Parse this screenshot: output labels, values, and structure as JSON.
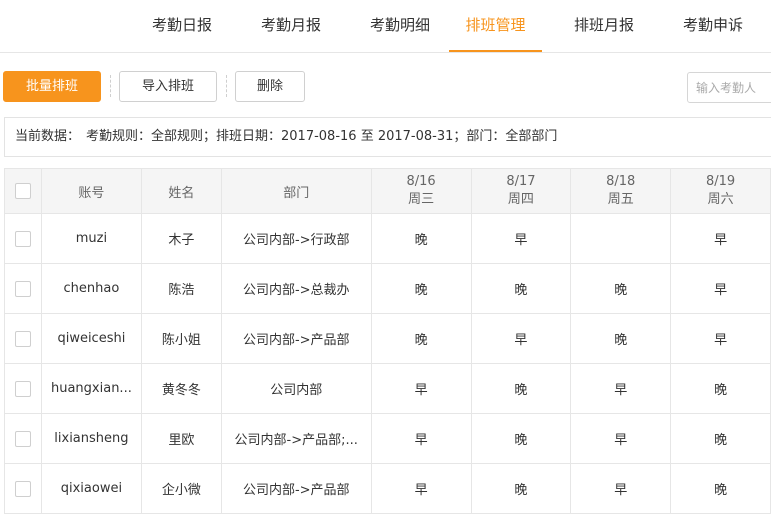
{
  "tabs": [
    {
      "label": "考勤日报",
      "active": false
    },
    {
      "label": "考勤月报",
      "active": false
    },
    {
      "label": "考勤明细",
      "active": false
    },
    {
      "label": "排班管理",
      "active": true
    },
    {
      "label": "排班月报",
      "active": false
    },
    {
      "label": "考勤申诉",
      "active": false
    }
  ],
  "toolbar": {
    "batch_label": "批量排班",
    "import_label": "导入排班",
    "delete_label": "删除",
    "search_placeholder": "输入考勤人"
  },
  "info": {
    "prefix": "当前数据：",
    "text": "考勤规则：全部规则；排班日期：2017-08-16 至 2017-08-31；部门：全部部门"
  },
  "table": {
    "headers": {
      "account": "账号",
      "name": "姓名",
      "dept": "部门"
    },
    "days": [
      {
        "date": "8/16",
        "weekday": "周三"
      },
      {
        "date": "8/17",
        "weekday": "周四"
      },
      {
        "date": "8/18",
        "weekday": "周五"
      },
      {
        "date": "8/19",
        "weekday": "周六"
      }
    ],
    "rows": [
      {
        "account": "muzi",
        "name": "木子",
        "dept": "公司内部->行政部",
        "shifts": [
          "晚",
          "早",
          "",
          "早"
        ]
      },
      {
        "account": "chenhao",
        "name": "陈浩",
        "dept": "公司内部->总裁办",
        "shifts": [
          "晚",
          "晚",
          "晚",
          "早"
        ]
      },
      {
        "account": "qiweiceshi",
        "name": "陈小姐",
        "dept": "公司内部->产品部",
        "shifts": [
          "晚",
          "早",
          "晚",
          "早"
        ]
      },
      {
        "account": "huangxian...",
        "name": "黄冬冬",
        "dept": "公司内部",
        "shifts": [
          "早",
          "晚",
          "早",
          "晚"
        ]
      },
      {
        "account": "lixiansheng",
        "name": "里欧",
        "dept": "公司内部->产品部;...",
        "shifts": [
          "早",
          "晚",
          "早",
          "晚"
        ]
      },
      {
        "account": "qixiaowei",
        "name": "企小微",
        "dept": "公司内部->产品部",
        "shifts": [
          "早",
          "晚",
          "早",
          "晚"
        ]
      }
    ]
  },
  "colors": {
    "accent": "#f7941d",
    "border": "#e6e6e6",
    "header_bg": "#f5f5f5"
  }
}
